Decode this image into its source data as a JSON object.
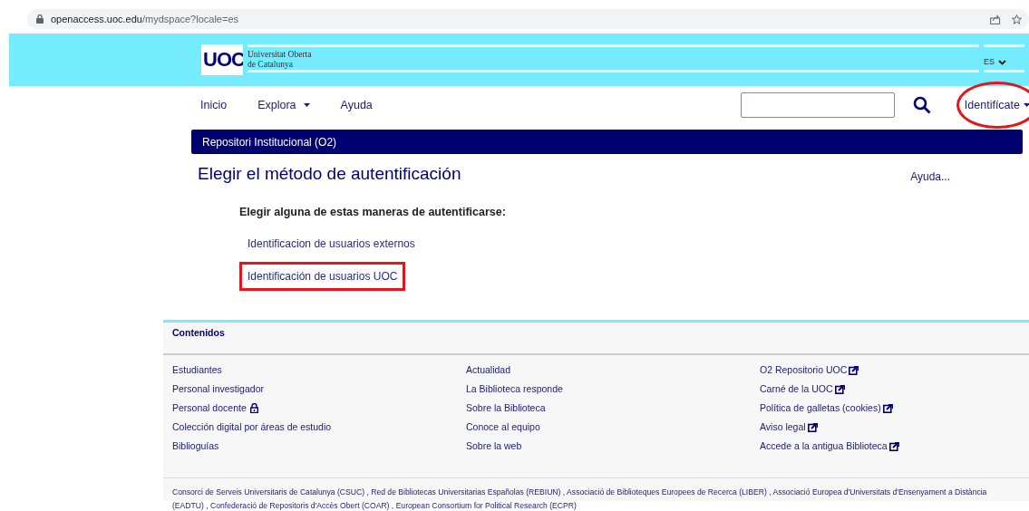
{
  "browser": {
    "url_host": "openaccess.uoc.edu",
    "url_path": "/mydspace?locale=es"
  },
  "header": {
    "logo_mark": "UOC",
    "logo_line_1": "Universitat Oberta",
    "logo_line_2": "de Catalunya",
    "language": "ES"
  },
  "nav": {
    "items": [
      {
        "label": "Inicio",
        "dropdown": false
      },
      {
        "label": "Explora",
        "dropdown": true
      },
      {
        "label": "Ayuda",
        "dropdown": false
      }
    ],
    "login": {
      "label": "Identifícate",
      "dropdown": true,
      "circled": true
    }
  },
  "breadcrumb": "Repositori Institucional (O2)",
  "page": {
    "title": "Elegir el método de autentificación",
    "help": "Ayuda...",
    "prompt": "Elegir alguna de estas maneras de autentificarse:",
    "methods": [
      {
        "label": "Identificacion de usuarios externos",
        "highlighted": false
      },
      {
        "label": "Identificación de usuarios UOC",
        "highlighted": true
      }
    ]
  },
  "footer": {
    "heading": "Contenidos",
    "columns": [
      {
        "links": [
          {
            "label": "Estudiantes",
            "kind": "plain"
          },
          {
            "label": "Personal investigador",
            "kind": "plain"
          },
          {
            "label": "Personal docente",
            "kind": "locked"
          },
          {
            "label": "Colección digital por áreas de estudio",
            "kind": "plain"
          },
          {
            "label": "Biblioguías",
            "kind": "plain"
          }
        ]
      },
      {
        "links": [
          {
            "label": "Actualidad",
            "kind": "plain"
          },
          {
            "label": "La Biblioteca responde",
            "kind": "plain"
          },
          {
            "label": "Sobre la Biblioteca",
            "kind": "plain"
          },
          {
            "label": "Conoce al equipo",
            "kind": "plain"
          },
          {
            "label": "Sobre la web",
            "kind": "plain"
          }
        ]
      },
      {
        "links": [
          {
            "label": "O2 Repositorio UOC",
            "kind": "external"
          },
          {
            "label": "Carné de la UOC",
            "kind": "external"
          },
          {
            "label": "Política de galletas (cookies)",
            "kind": "external"
          },
          {
            "label": "Aviso legal",
            "kind": "external"
          },
          {
            "label": "Accede a la antigua Biblioteca",
            "kind": "external"
          }
        ]
      }
    ],
    "partners": "Consorci de Serveis Universitaris de Catalunya (CSUC) , Red de Bibliotecas Universitarias Españolas (REBIUN) , Associació de Biblioteques Europees de Recerca (LIBER) , Associació Europea d'Universitats d'Ensenyament a Distància (EADTU) , Confederació de Repositoris d'Accès Obert (COAR) , European Consortium for Political Research (ECPR)"
  }
}
